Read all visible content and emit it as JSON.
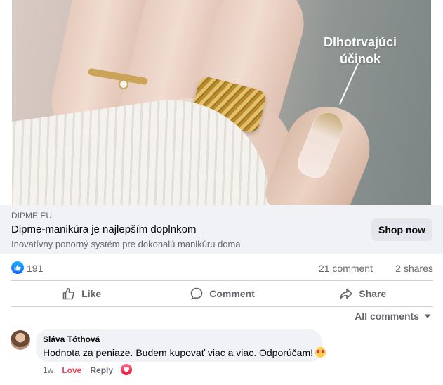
{
  "ad": {
    "caption_line1": "Dlhotrvajúci",
    "caption_line2": "účinok"
  },
  "link_preview": {
    "domain": "DIPME.EU",
    "title": "Dipme-manikúra je najlepším doplnkom",
    "description": "Inovatívny ponorný systém pre dokonalú manikúru doma",
    "cta_label": "Shop now"
  },
  "reactions": {
    "count": "191",
    "comments": "21 comment",
    "shares": "2 shares",
    "like_color": "#0866ff"
  },
  "actions": {
    "like_label": "Like",
    "comment_label": "Comment",
    "share_label": "Share"
  },
  "comments_filter": {
    "label": "All comments",
    "icon": "caret-down-icon"
  },
  "comments": [
    {
      "author": "Sláva Tóthová",
      "text": "Hodnota za peniaze. Budem kupovať viac a viac. Odporúčam!",
      "emoji": "smiling-face-with-hearts-emoji",
      "time": "1w",
      "love_label": "Love",
      "reply_label": "Reply",
      "love_color": "#f33e58"
    }
  ]
}
